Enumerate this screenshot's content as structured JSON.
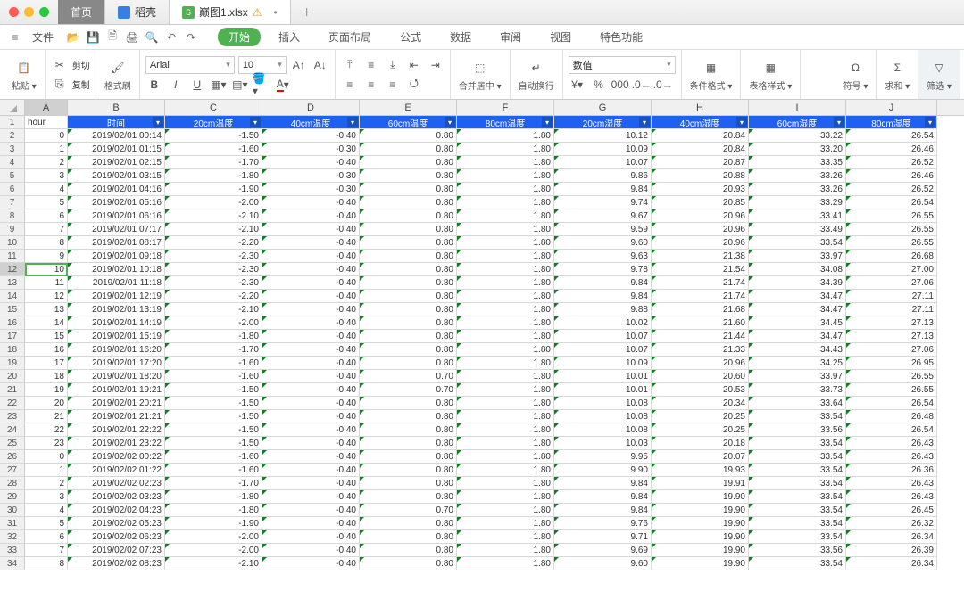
{
  "titlebar": {
    "tabs": [
      {
        "label": "首页",
        "type": "home"
      },
      {
        "label": "稻壳",
        "iconColor": "#3a7fe0"
      },
      {
        "label": "巅图1.xlsx",
        "iconColor": "#4fb14f",
        "warn": "⚠",
        "dirty": "•"
      }
    ]
  },
  "menu": {
    "file": "文件"
  },
  "ribbon_tabs": [
    "开始",
    "插入",
    "页面布局",
    "公式",
    "数据",
    "审阅",
    "视图",
    "特色功能"
  ],
  "ribbon": {
    "paste": "粘贴",
    "cut": "剪切",
    "copy": "复制",
    "format_painter": "格式刷",
    "font": "Arial",
    "size": "10",
    "merge": "合并居中",
    "wrap": "自动换行",
    "numfmt": "数值",
    "condfmt": "条件格式",
    "tablestyle": "表格样式",
    "symbol": "符号",
    "sum": "求和",
    "filter": "筛选"
  },
  "columns": [
    "A",
    "B",
    "C",
    "D",
    "E",
    "F",
    "G",
    "H",
    "I",
    "J"
  ],
  "headers": [
    "hour",
    "时间",
    "20cm温度",
    "40cm温度",
    "60cm温度",
    "80cm温度",
    "20cm湿度",
    "40cm湿度",
    "60cm湿度",
    "80cm湿度"
  ],
  "rows": [
    {
      "n": 2,
      "a": "0",
      "b": "2019/02/01 00:14",
      "c": "-1.50",
      "d": "-0.40",
      "e": "0.80",
      "f": "1.80",
      "g": "10.12",
      "h": "20.84",
      "i": "33.22",
      "j": "26.54"
    },
    {
      "n": 3,
      "a": "1",
      "b": "2019/02/01 01:15",
      "c": "-1.60",
      "d": "-0.30",
      "e": "0.80",
      "f": "1.80",
      "g": "10.09",
      "h": "20.84",
      "i": "33.20",
      "j": "26.46"
    },
    {
      "n": 4,
      "a": "2",
      "b": "2019/02/01 02:15",
      "c": "-1.70",
      "d": "-0.40",
      "e": "0.80",
      "f": "1.80",
      "g": "10.07",
      "h": "20.87",
      "i": "33.35",
      "j": "26.52"
    },
    {
      "n": 5,
      "a": "3",
      "b": "2019/02/01 03:15",
      "c": "-1.80",
      "d": "-0.30",
      "e": "0.80",
      "f": "1.80",
      "g": "9.86",
      "h": "20.88",
      "i": "33.26",
      "j": "26.46"
    },
    {
      "n": 6,
      "a": "4",
      "b": "2019/02/01 04:16",
      "c": "-1.90",
      "d": "-0.30",
      "e": "0.80",
      "f": "1.80",
      "g": "9.84",
      "h": "20.93",
      "i": "33.26",
      "j": "26.52"
    },
    {
      "n": 7,
      "a": "5",
      "b": "2019/02/01 05:16",
      "c": "-2.00",
      "d": "-0.40",
      "e": "0.80",
      "f": "1.80",
      "g": "9.74",
      "h": "20.85",
      "i": "33.29",
      "j": "26.54"
    },
    {
      "n": 8,
      "a": "6",
      "b": "2019/02/01 06:16",
      "c": "-2.10",
      "d": "-0.40",
      "e": "0.80",
      "f": "1.80",
      "g": "9.67",
      "h": "20.96",
      "i": "33.41",
      "j": "26.55"
    },
    {
      "n": 9,
      "a": "7",
      "b": "2019/02/01 07:17",
      "c": "-2.10",
      "d": "-0.40",
      "e": "0.80",
      "f": "1.80",
      "g": "9.59",
      "h": "20.96",
      "i": "33.49",
      "j": "26.55"
    },
    {
      "n": 10,
      "a": "8",
      "b": "2019/02/01 08:17",
      "c": "-2.20",
      "d": "-0.40",
      "e": "0.80",
      "f": "1.80",
      "g": "9.60",
      "h": "20.96",
      "i": "33.54",
      "j": "26.55"
    },
    {
      "n": 11,
      "a": "9",
      "b": "2019/02/01 09:18",
      "c": "-2.30",
      "d": "-0.40",
      "e": "0.80",
      "f": "1.80",
      "g": "9.63",
      "h": "21.38",
      "i": "33.97",
      "j": "26.68"
    },
    {
      "n": 12,
      "a": "10",
      "b": "2019/02/01 10:18",
      "c": "-2.30",
      "d": "-0.40",
      "e": "0.80",
      "f": "1.80",
      "g": "9.78",
      "h": "21.54",
      "i": "34.08",
      "j": "27.00"
    },
    {
      "n": 13,
      "a": "11",
      "b": "2019/02/01 11:18",
      "c": "-2.30",
      "d": "-0.40",
      "e": "0.80",
      "f": "1.80",
      "g": "9.84",
      "h": "21.74",
      "i": "34.39",
      "j": "27.06"
    },
    {
      "n": 14,
      "a": "12",
      "b": "2019/02/01 12:19",
      "c": "-2.20",
      "d": "-0.40",
      "e": "0.80",
      "f": "1.80",
      "g": "9.84",
      "h": "21.74",
      "i": "34.47",
      "j": "27.11"
    },
    {
      "n": 15,
      "a": "13",
      "b": "2019/02/01 13:19",
      "c": "-2.10",
      "d": "-0.40",
      "e": "0.80",
      "f": "1.80",
      "g": "9.88",
      "h": "21.68",
      "i": "34.47",
      "j": "27.11"
    },
    {
      "n": 16,
      "a": "14",
      "b": "2019/02/01 14:19",
      "c": "-2.00",
      "d": "-0.40",
      "e": "0.80",
      "f": "1.80",
      "g": "10.02",
      "h": "21.60",
      "i": "34.45",
      "j": "27.13"
    },
    {
      "n": 17,
      "a": "15",
      "b": "2019/02/01 15:19",
      "c": "-1.80",
      "d": "-0.40",
      "e": "0.80",
      "f": "1.80",
      "g": "10.07",
      "h": "21.44",
      "i": "34.47",
      "j": "27.13"
    },
    {
      "n": 18,
      "a": "16",
      "b": "2019/02/01 16:20",
      "c": "-1.70",
      "d": "-0.40",
      "e": "0.80",
      "f": "1.80",
      "g": "10.07",
      "h": "21.33",
      "i": "34.43",
      "j": "27.06"
    },
    {
      "n": 19,
      "a": "17",
      "b": "2019/02/01 17:20",
      "c": "-1.60",
      "d": "-0.40",
      "e": "0.80",
      "f": "1.80",
      "g": "10.09",
      "h": "20.96",
      "i": "34.25",
      "j": "26.95"
    },
    {
      "n": 20,
      "a": "18",
      "b": "2019/02/01 18:20",
      "c": "-1.60",
      "d": "-0.40",
      "e": "0.70",
      "f": "1.80",
      "g": "10.01",
      "h": "20.60",
      "i": "33.97",
      "j": "26.55"
    },
    {
      "n": 21,
      "a": "19",
      "b": "2019/02/01 19:21",
      "c": "-1.50",
      "d": "-0.40",
      "e": "0.70",
      "f": "1.80",
      "g": "10.01",
      "h": "20.53",
      "i": "33.73",
      "j": "26.55"
    },
    {
      "n": 22,
      "a": "20",
      "b": "2019/02/01 20:21",
      "c": "-1.50",
      "d": "-0.40",
      "e": "0.80",
      "f": "1.80",
      "g": "10.08",
      "h": "20.34",
      "i": "33.64",
      "j": "26.54"
    },
    {
      "n": 23,
      "a": "21",
      "b": "2019/02/01 21:21",
      "c": "-1.50",
      "d": "-0.40",
      "e": "0.80",
      "f": "1.80",
      "g": "10.08",
      "h": "20.25",
      "i": "33.54",
      "j": "26.48"
    },
    {
      "n": 24,
      "a": "22",
      "b": "2019/02/01 22:22",
      "c": "-1.50",
      "d": "-0.40",
      "e": "0.80",
      "f": "1.80",
      "g": "10.08",
      "h": "20.25",
      "i": "33.56",
      "j": "26.54"
    },
    {
      "n": 25,
      "a": "23",
      "b": "2019/02/01 23:22",
      "c": "-1.50",
      "d": "-0.40",
      "e": "0.80",
      "f": "1.80",
      "g": "10.03",
      "h": "20.18",
      "i": "33.54",
      "j": "26.43"
    },
    {
      "n": 26,
      "a": "0",
      "b": "2019/02/02 00:22",
      "c": "-1.60",
      "d": "-0.40",
      "e": "0.80",
      "f": "1.80",
      "g": "9.95",
      "h": "20.07",
      "i": "33.54",
      "j": "26.43"
    },
    {
      "n": 27,
      "a": "1",
      "b": "2019/02/02 01:22",
      "c": "-1.60",
      "d": "-0.40",
      "e": "0.80",
      "f": "1.80",
      "g": "9.90",
      "h": "19.93",
      "i": "33.54",
      "j": "26.36"
    },
    {
      "n": 28,
      "a": "2",
      "b": "2019/02/02 02:23",
      "c": "-1.70",
      "d": "-0.40",
      "e": "0.80",
      "f": "1.80",
      "g": "9.84",
      "h": "19.91",
      "i": "33.54",
      "j": "26.43"
    },
    {
      "n": 29,
      "a": "3",
      "b": "2019/02/02 03:23",
      "c": "-1.80",
      "d": "-0.40",
      "e": "0.80",
      "f": "1.80",
      "g": "9.84",
      "h": "19.90",
      "i": "33.54",
      "j": "26.43"
    },
    {
      "n": 30,
      "a": "4",
      "b": "2019/02/02 04:23",
      "c": "-1.80",
      "d": "-0.40",
      "e": "0.70",
      "f": "1.80",
      "g": "9.84",
      "h": "19.90",
      "i": "33.54",
      "j": "26.45"
    },
    {
      "n": 31,
      "a": "5",
      "b": "2019/02/02 05:23",
      "c": "-1.90",
      "d": "-0.40",
      "e": "0.80",
      "f": "1.80",
      "g": "9.76",
      "h": "19.90",
      "i": "33.54",
      "j": "26.32"
    },
    {
      "n": 32,
      "a": "6",
      "b": "2019/02/02 06:23",
      "c": "-2.00",
      "d": "-0.40",
      "e": "0.80",
      "f": "1.80",
      "g": "9.71",
      "h": "19.90",
      "i": "33.54",
      "j": "26.34"
    },
    {
      "n": 33,
      "a": "7",
      "b": "2019/02/02 07:23",
      "c": "-2.00",
      "d": "-0.40",
      "e": "0.80",
      "f": "1.80",
      "g": "9.69",
      "h": "19.90",
      "i": "33.56",
      "j": "26.39"
    },
    {
      "n": 34,
      "a": "8",
      "b": "2019/02/02 08:23",
      "c": "-2.10",
      "d": "-0.40",
      "e": "0.80",
      "f": "1.80",
      "g": "9.60",
      "h": "19.90",
      "i": "33.54",
      "j": "26.34"
    }
  ]
}
